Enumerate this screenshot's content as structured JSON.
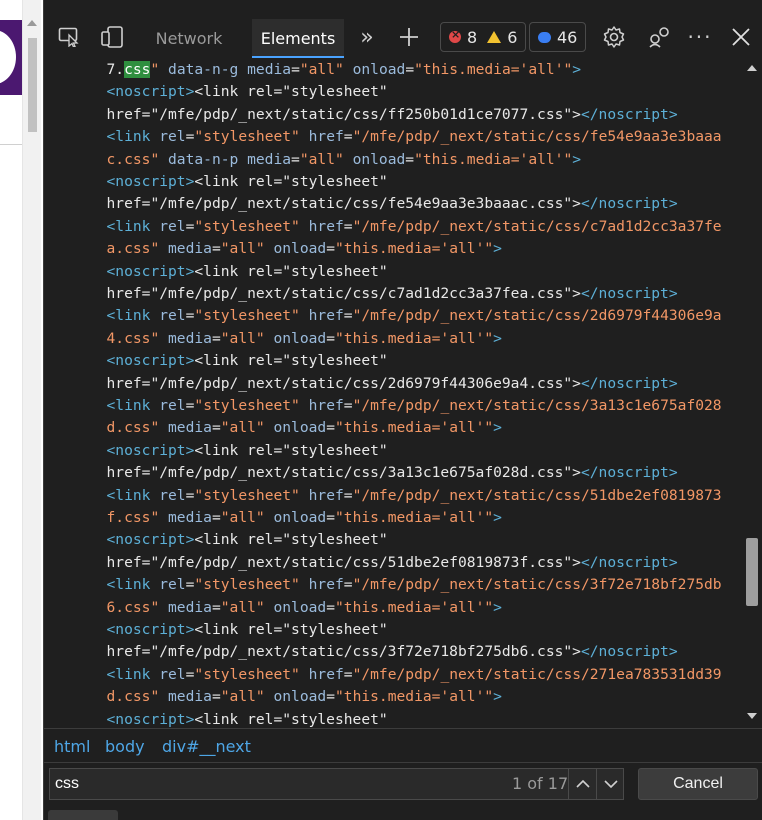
{
  "toolbar": {
    "tabs": {
      "network": "Network",
      "elements": "Elements"
    },
    "errors": "8",
    "warnings": "6",
    "messages": "46"
  },
  "colors": {
    "tag": "#5db0d7",
    "attr": "#9bbbdc",
    "value": "#f29766",
    "accent": "#4aa3ff",
    "match_highlight": "#2f8f3f"
  },
  "code_lines": [
    {
      "indent": 7,
      "tokens": [
        {
          "c": "plain",
          "t": "7."
        },
        {
          "c": "hl",
          "t": "css"
        },
        {
          "c": "val",
          "t": "\""
        },
        {
          "c": "attr",
          "t": " data-n-g "
        },
        {
          "c": "attr",
          "t": "media"
        },
        {
          "c": "plain",
          "t": "="
        },
        {
          "c": "val",
          "t": "\"all\""
        },
        {
          "c": "attr",
          "t": " onload"
        },
        {
          "c": "plain",
          "t": "="
        },
        {
          "c": "val",
          "t": "\"this.media='all'\""
        },
        {
          "c": "tag",
          "t": ">"
        }
      ]
    },
    {
      "indent": 7,
      "tokens": [
        {
          "c": "tag",
          "t": "<noscript>"
        },
        {
          "c": "plain",
          "t": "<link rel=\"stylesheet\""
        }
      ]
    },
    {
      "indent": 7,
      "tokens": [
        {
          "c": "plain",
          "t": "href=\"/mfe/pdp/_next/static/css/ff250b01d1ce7077.css\">"
        },
        {
          "c": "tag",
          "t": "</noscript>"
        }
      ]
    },
    {
      "indent": 7,
      "tokens": [
        {
          "c": "tag",
          "t": "<link"
        },
        {
          "c": "attr",
          "t": " rel"
        },
        {
          "c": "plain",
          "t": "="
        },
        {
          "c": "val",
          "t": "\"stylesheet\""
        },
        {
          "c": "attr",
          "t": " href"
        },
        {
          "c": "plain",
          "t": "="
        },
        {
          "c": "val",
          "t": "\"/mfe/pdp/_next/static/css/fe54e9aa3e3baaa"
        }
      ]
    },
    {
      "indent": 7,
      "tokens": [
        {
          "c": "val",
          "t": "c.css\""
        },
        {
          "c": "attr",
          "t": " data-n-p "
        },
        {
          "c": "attr",
          "t": "media"
        },
        {
          "c": "plain",
          "t": "="
        },
        {
          "c": "val",
          "t": "\"all\""
        },
        {
          "c": "attr",
          "t": " onload"
        },
        {
          "c": "plain",
          "t": "="
        },
        {
          "c": "val",
          "t": "\"this.media='all'\""
        },
        {
          "c": "tag",
          "t": ">"
        }
      ]
    },
    {
      "indent": 7,
      "tokens": [
        {
          "c": "tag",
          "t": "<noscript>"
        },
        {
          "c": "plain",
          "t": "<link rel=\"stylesheet\""
        }
      ]
    },
    {
      "indent": 7,
      "tokens": [
        {
          "c": "plain",
          "t": "href=\"/mfe/pdp/_next/static/css/fe54e9aa3e3baaac.css\">"
        },
        {
          "c": "tag",
          "t": "</noscript>"
        }
      ]
    },
    {
      "indent": 7,
      "tokens": [
        {
          "c": "tag",
          "t": "<link"
        },
        {
          "c": "attr",
          "t": " rel"
        },
        {
          "c": "plain",
          "t": "="
        },
        {
          "c": "val",
          "t": "\"stylesheet\""
        },
        {
          "c": "attr",
          "t": " href"
        },
        {
          "c": "plain",
          "t": "="
        },
        {
          "c": "val",
          "t": "\"/mfe/pdp/_next/static/css/c7ad1d2cc3a37fe"
        }
      ]
    },
    {
      "indent": 7,
      "tokens": [
        {
          "c": "val",
          "t": "a.css\""
        },
        {
          "c": "attr",
          "t": " media"
        },
        {
          "c": "plain",
          "t": "="
        },
        {
          "c": "val",
          "t": "\"all\""
        },
        {
          "c": "attr",
          "t": " onload"
        },
        {
          "c": "plain",
          "t": "="
        },
        {
          "c": "val",
          "t": "\"this.media='all'\""
        },
        {
          "c": "tag",
          "t": ">"
        }
      ]
    },
    {
      "indent": 7,
      "tokens": [
        {
          "c": "tag",
          "t": "<noscript>"
        },
        {
          "c": "plain",
          "t": "<link rel=\"stylesheet\""
        }
      ]
    },
    {
      "indent": 7,
      "tokens": [
        {
          "c": "plain",
          "t": "href=\"/mfe/pdp/_next/static/css/c7ad1d2cc3a37fea.css\">"
        },
        {
          "c": "tag",
          "t": "</noscript>"
        }
      ]
    },
    {
      "indent": 7,
      "tokens": [
        {
          "c": "tag",
          "t": "<link"
        },
        {
          "c": "attr",
          "t": " rel"
        },
        {
          "c": "plain",
          "t": "="
        },
        {
          "c": "val",
          "t": "\"stylesheet\""
        },
        {
          "c": "attr",
          "t": " href"
        },
        {
          "c": "plain",
          "t": "="
        },
        {
          "c": "val",
          "t": "\"/mfe/pdp/_next/static/css/2d6979f44306e9a"
        }
      ]
    },
    {
      "indent": 7,
      "tokens": [
        {
          "c": "val",
          "t": "4.css\""
        },
        {
          "c": "attr",
          "t": " media"
        },
        {
          "c": "plain",
          "t": "="
        },
        {
          "c": "val",
          "t": "\"all\""
        },
        {
          "c": "attr",
          "t": " onload"
        },
        {
          "c": "plain",
          "t": "="
        },
        {
          "c": "val",
          "t": "\"this.media='all'\""
        },
        {
          "c": "tag",
          "t": ">"
        }
      ]
    },
    {
      "indent": 7,
      "tokens": [
        {
          "c": "tag",
          "t": "<noscript>"
        },
        {
          "c": "plain",
          "t": "<link rel=\"stylesheet\""
        }
      ]
    },
    {
      "indent": 7,
      "tokens": [
        {
          "c": "plain",
          "t": "href=\"/mfe/pdp/_next/static/css/2d6979f44306e9a4.css\">"
        },
        {
          "c": "tag",
          "t": "</noscript>"
        }
      ]
    },
    {
      "indent": 7,
      "tokens": [
        {
          "c": "tag",
          "t": "<link"
        },
        {
          "c": "attr",
          "t": " rel"
        },
        {
          "c": "plain",
          "t": "="
        },
        {
          "c": "val",
          "t": "\"stylesheet\""
        },
        {
          "c": "attr",
          "t": " href"
        },
        {
          "c": "plain",
          "t": "="
        },
        {
          "c": "val",
          "t": "\"/mfe/pdp/_next/static/css/3a13c1e675af028"
        }
      ]
    },
    {
      "indent": 7,
      "tokens": [
        {
          "c": "val",
          "t": "d.css\""
        },
        {
          "c": "attr",
          "t": " media"
        },
        {
          "c": "plain",
          "t": "="
        },
        {
          "c": "val",
          "t": "\"all\""
        },
        {
          "c": "attr",
          "t": " onload"
        },
        {
          "c": "plain",
          "t": "="
        },
        {
          "c": "val",
          "t": "\"this.media='all'\""
        },
        {
          "c": "tag",
          "t": ">"
        }
      ]
    },
    {
      "indent": 7,
      "tokens": [
        {
          "c": "tag",
          "t": "<noscript>"
        },
        {
          "c": "plain",
          "t": "<link rel=\"stylesheet\""
        }
      ]
    },
    {
      "indent": 7,
      "tokens": [
        {
          "c": "plain",
          "t": "href=\"/mfe/pdp/_next/static/css/3a13c1e675af028d.css\">"
        },
        {
          "c": "tag",
          "t": "</noscript>"
        }
      ]
    },
    {
      "indent": 7,
      "tokens": [
        {
          "c": "tag",
          "t": "<link"
        },
        {
          "c": "attr",
          "t": " rel"
        },
        {
          "c": "plain",
          "t": "="
        },
        {
          "c": "val",
          "t": "\"stylesheet\""
        },
        {
          "c": "attr",
          "t": " href"
        },
        {
          "c": "plain",
          "t": "="
        },
        {
          "c": "val",
          "t": "\"/mfe/pdp/_next/static/css/51dbe2ef0819873"
        }
      ]
    },
    {
      "indent": 7,
      "tokens": [
        {
          "c": "val",
          "t": "f.css\""
        },
        {
          "c": "attr",
          "t": " media"
        },
        {
          "c": "plain",
          "t": "="
        },
        {
          "c": "val",
          "t": "\"all\""
        },
        {
          "c": "attr",
          "t": " onload"
        },
        {
          "c": "plain",
          "t": "="
        },
        {
          "c": "val",
          "t": "\"this.media='all'\""
        },
        {
          "c": "tag",
          "t": ">"
        }
      ]
    },
    {
      "indent": 7,
      "tokens": [
        {
          "c": "tag",
          "t": "<noscript>"
        },
        {
          "c": "plain",
          "t": "<link rel=\"stylesheet\""
        }
      ]
    },
    {
      "indent": 7,
      "tokens": [
        {
          "c": "plain",
          "t": "href=\"/mfe/pdp/_next/static/css/51dbe2ef0819873f.css\">"
        },
        {
          "c": "tag",
          "t": "</noscript>"
        }
      ]
    },
    {
      "indent": 7,
      "tokens": [
        {
          "c": "tag",
          "t": "<link"
        },
        {
          "c": "attr",
          "t": " rel"
        },
        {
          "c": "plain",
          "t": "="
        },
        {
          "c": "val",
          "t": "\"stylesheet\""
        },
        {
          "c": "attr",
          "t": " href"
        },
        {
          "c": "plain",
          "t": "="
        },
        {
          "c": "val",
          "t": "\"/mfe/pdp/_next/static/css/3f72e718bf275db"
        }
      ]
    },
    {
      "indent": 7,
      "tokens": [
        {
          "c": "val",
          "t": "6.css\""
        },
        {
          "c": "attr",
          "t": " media"
        },
        {
          "c": "plain",
          "t": "="
        },
        {
          "c": "val",
          "t": "\"all\""
        },
        {
          "c": "attr",
          "t": " onload"
        },
        {
          "c": "plain",
          "t": "="
        },
        {
          "c": "val",
          "t": "\"this.media='all'\""
        },
        {
          "c": "tag",
          "t": ">"
        }
      ]
    },
    {
      "indent": 7,
      "tokens": [
        {
          "c": "tag",
          "t": "<noscript>"
        },
        {
          "c": "plain",
          "t": "<link rel=\"stylesheet\""
        }
      ]
    },
    {
      "indent": 7,
      "tokens": [
        {
          "c": "plain",
          "t": "href=\"/mfe/pdp/_next/static/css/3f72e718bf275db6.css\">"
        },
        {
          "c": "tag",
          "t": "</noscript>"
        }
      ]
    },
    {
      "indent": 7,
      "tokens": [
        {
          "c": "tag",
          "t": "<link"
        },
        {
          "c": "attr",
          "t": " rel"
        },
        {
          "c": "plain",
          "t": "="
        },
        {
          "c": "val",
          "t": "\"stylesheet\""
        },
        {
          "c": "attr",
          "t": " href"
        },
        {
          "c": "plain",
          "t": "="
        },
        {
          "c": "val",
          "t": "\"/mfe/pdp/_next/static/css/271ea783531dd39"
        }
      ]
    },
    {
      "indent": 7,
      "tokens": [
        {
          "c": "val",
          "t": "d.css\""
        },
        {
          "c": "attr",
          "t": " media"
        },
        {
          "c": "plain",
          "t": "="
        },
        {
          "c": "val",
          "t": "\"all\""
        },
        {
          "c": "attr",
          "t": " onload"
        },
        {
          "c": "plain",
          "t": "="
        },
        {
          "c": "val",
          "t": "\"this.media='all'\""
        },
        {
          "c": "tag",
          "t": ">"
        }
      ]
    },
    {
      "indent": 7,
      "tokens": [
        {
          "c": "tag",
          "t": "<noscript>"
        },
        {
          "c": "plain",
          "t": "<link rel=\"stylesheet\""
        }
      ]
    }
  ],
  "breadcrumbs": [
    "html",
    "body",
    "div#__next"
  ],
  "search": {
    "value": "css",
    "match_count": "1 of 17",
    "cancel_label": "Cancel"
  }
}
